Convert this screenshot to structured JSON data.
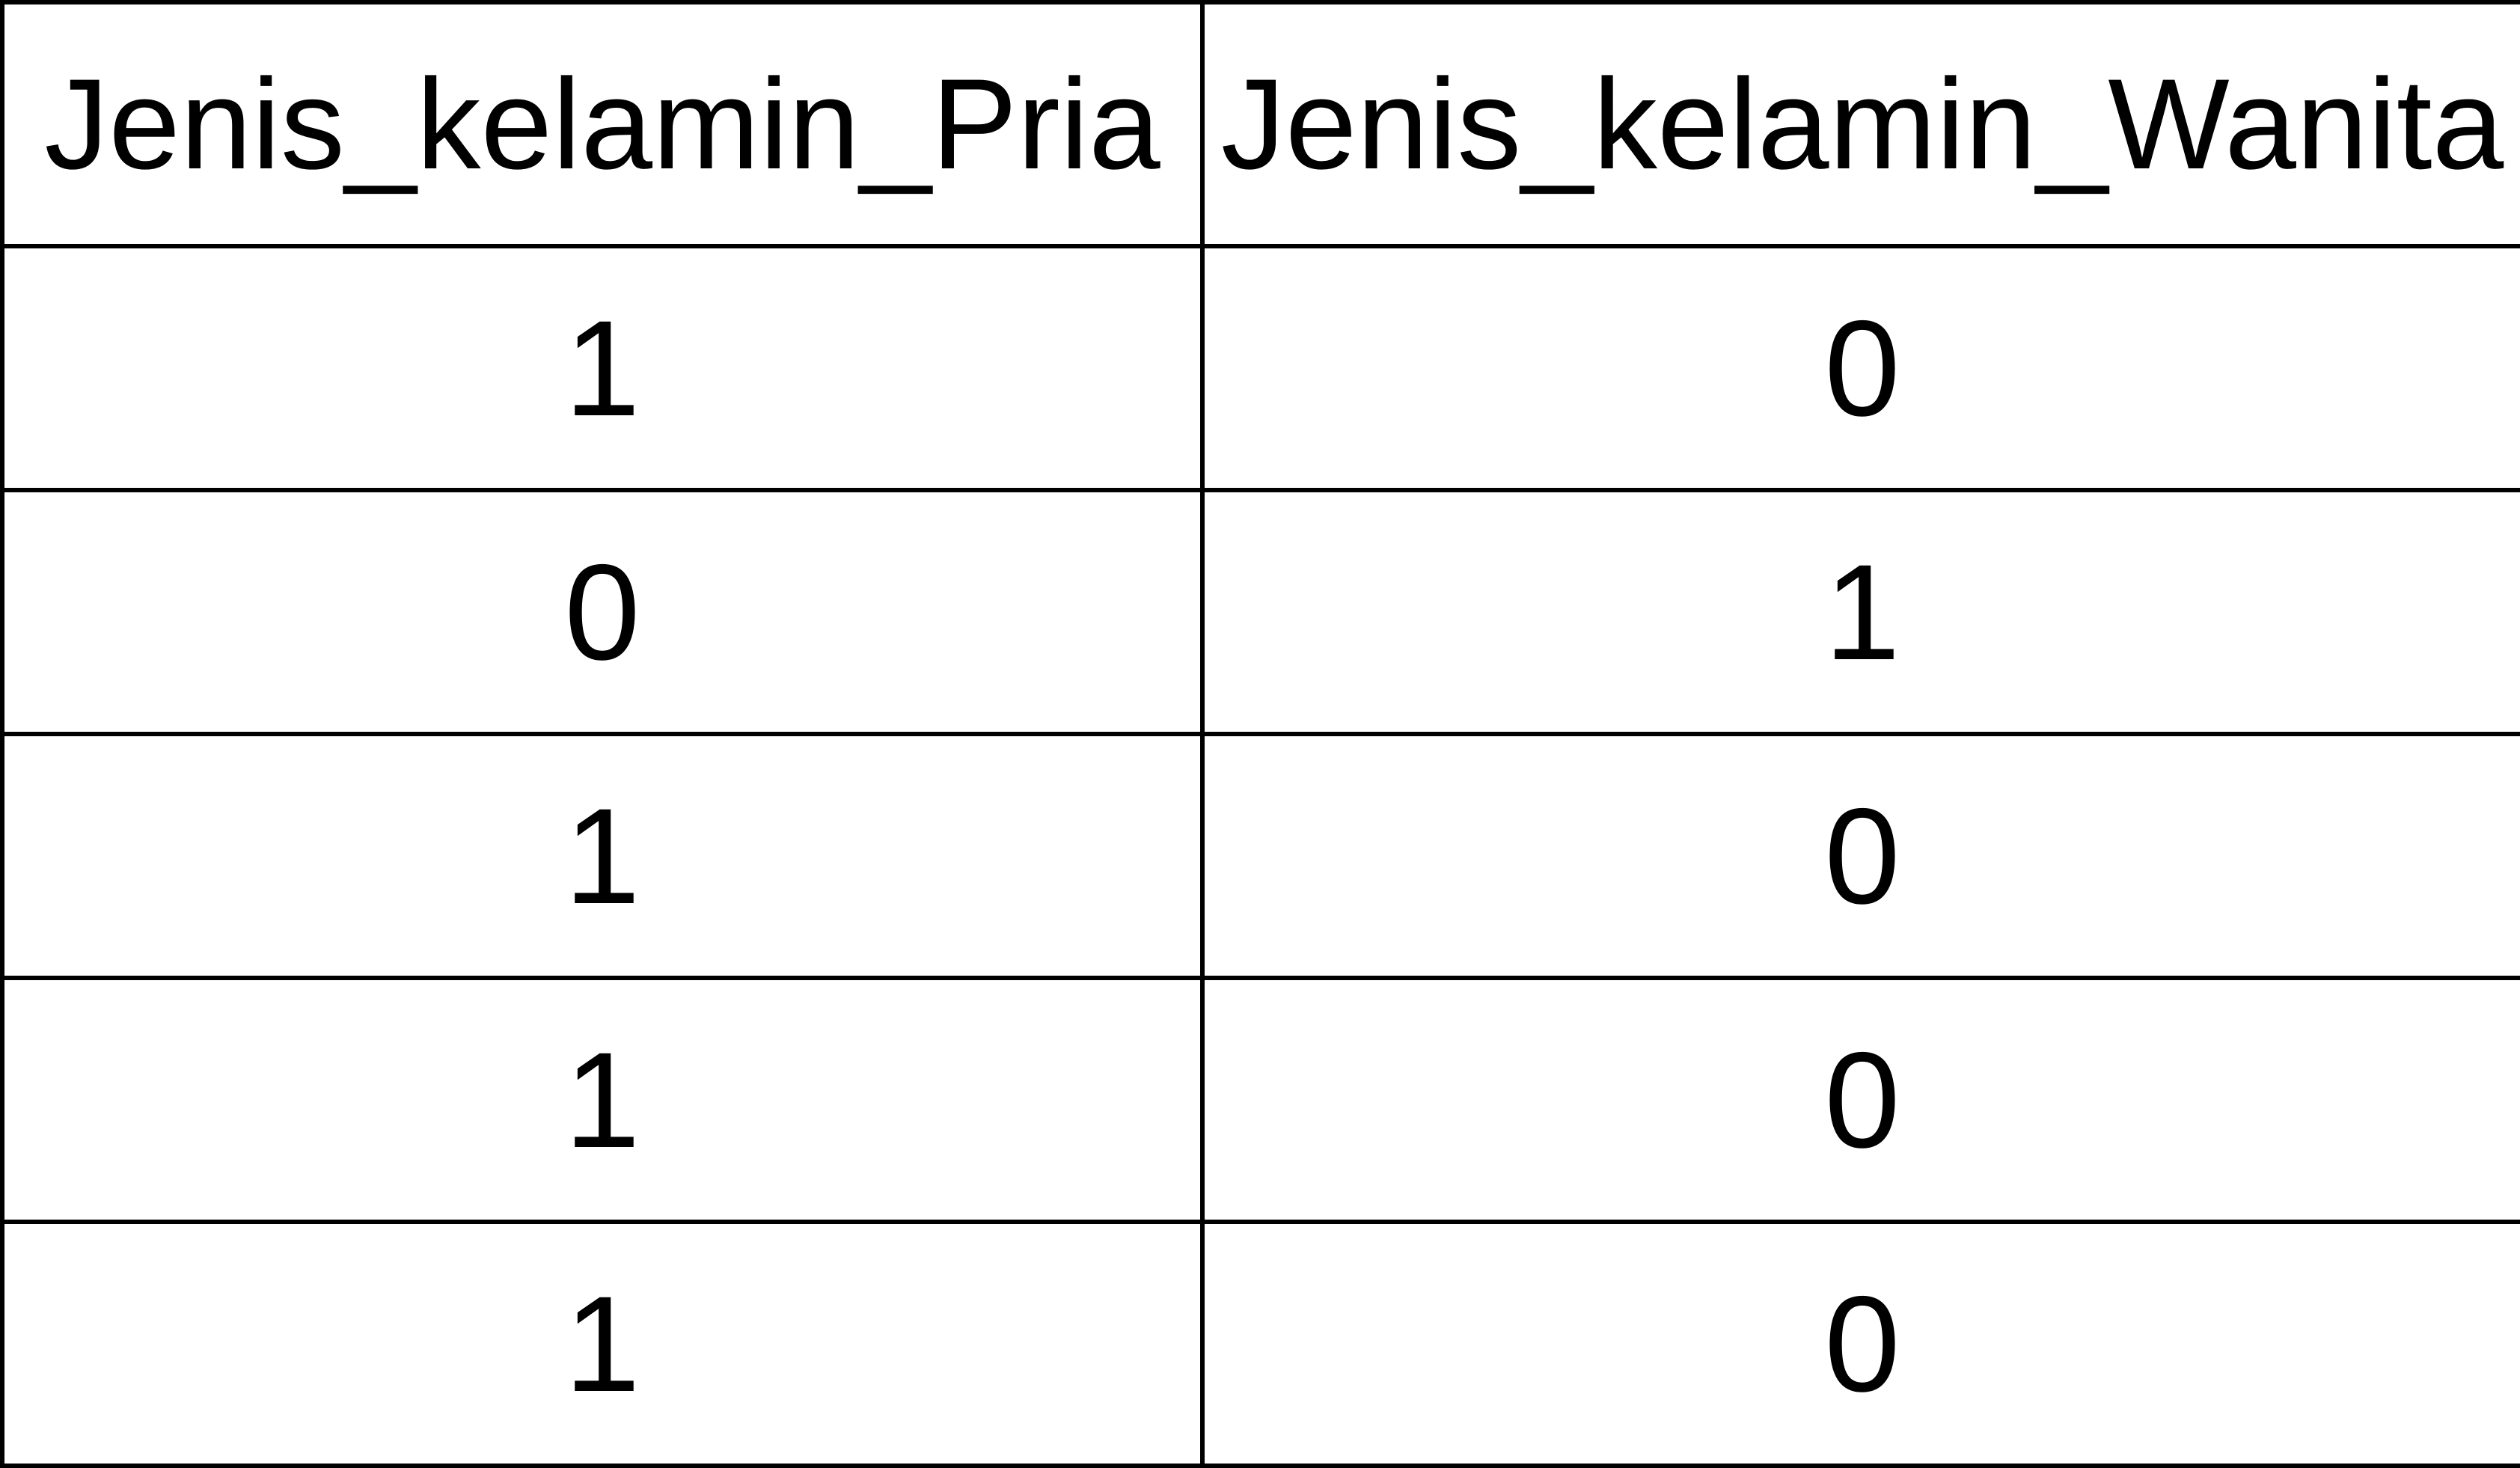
{
  "table": {
    "headers": [
      "Jenis_kelamin_Pria",
      "Jenis_kelamin_Wanita"
    ],
    "rows": [
      [
        "1",
        "0"
      ],
      [
        "0",
        "1"
      ],
      [
        "1",
        "0"
      ],
      [
        "1",
        "0"
      ],
      [
        "1",
        "0"
      ]
    ]
  }
}
